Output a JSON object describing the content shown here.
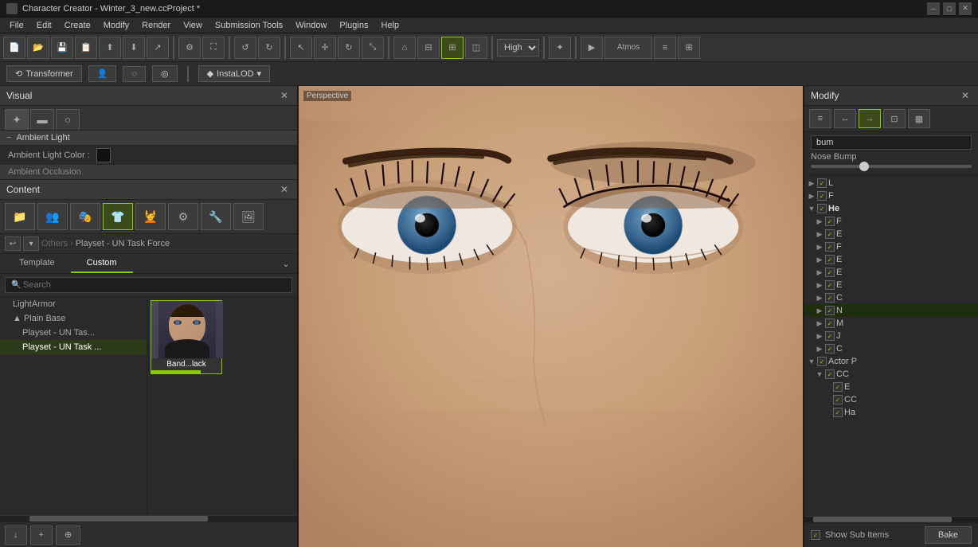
{
  "titleBar": {
    "title": "Character Creator - Winter_3_new.ccProject *",
    "icon": "★"
  },
  "menuBar": {
    "items": [
      "File",
      "Edit",
      "Create",
      "Modify",
      "Render",
      "View",
      "Submission Tools",
      "Window",
      "Plugins",
      "Help"
    ]
  },
  "toolbar": {
    "quality": "High",
    "atmos": "Atmos"
  },
  "subToolbar": {
    "transformer": "Transformer",
    "instaLOD": "InstaLOD"
  },
  "leftPanel": {
    "visualPanel": {
      "title": "Visual",
      "ambientLight": "Ambient Light",
      "ambientLightColor": "Ambient Light Color :",
      "ambientOcclusion": "Ambient Occlusion"
    },
    "contentPanel": {
      "title": "Content",
      "breadcrumb": [
        "Others",
        "Playset - UN Task Force"
      ],
      "tabs": [
        "Template",
        "Custom"
      ],
      "activeTab": "Custom",
      "searchPlaceholder": "Search",
      "listItems": [
        {
          "label": "LightArmor",
          "indent": 0,
          "selected": false
        },
        {
          "label": "▲ Plain Base",
          "indent": 0,
          "selected": false
        },
        {
          "label": "Playset - UN Tas...",
          "indent": 1,
          "selected": false
        },
        {
          "label": "Playset - UN Task ...",
          "indent": 1,
          "selected": true
        }
      ],
      "thumbItems": [
        {
          "label": "Band...lack",
          "selected": true
        }
      ],
      "bottomButtons": [
        "↓",
        "+",
        "⊕"
      ]
    }
  },
  "viewport": {
    "label": "Perspective"
  },
  "rightPanel": {
    "title": "Modify",
    "treeItems": [
      {
        "label": "L",
        "level": 0,
        "checked": true,
        "expanded": false
      },
      {
        "label": "F",
        "level": 0,
        "checked": true,
        "expanded": false
      },
      {
        "label": "He",
        "level": 0,
        "checked": true,
        "expanded": true,
        "bold": true
      },
      {
        "label": "F",
        "level": 1,
        "checked": true,
        "expanded": false
      },
      {
        "label": "E",
        "level": 1,
        "checked": true,
        "expanded": false
      },
      {
        "label": "F",
        "level": 1,
        "checked": true,
        "expanded": false
      },
      {
        "label": "E",
        "level": 1,
        "checked": true,
        "expanded": false
      },
      {
        "label": "E",
        "level": 1,
        "checked": true,
        "expanded": false
      },
      {
        "label": "E",
        "level": 1,
        "checked": true,
        "expanded": false
      },
      {
        "label": "C",
        "level": 1,
        "checked": true,
        "expanded": false
      },
      {
        "label": "N",
        "level": 1,
        "checked": true,
        "expanded": false,
        "selected": true
      },
      {
        "label": "M",
        "level": 1,
        "checked": true,
        "expanded": false
      },
      {
        "label": "J",
        "level": 1,
        "checked": true,
        "expanded": false
      },
      {
        "label": "C",
        "level": 1,
        "checked": true,
        "expanded": false
      },
      {
        "label": "Actor P",
        "level": 0,
        "checked": true,
        "expanded": true
      },
      {
        "label": "CC",
        "level": 1,
        "checked": true,
        "expanded": true
      },
      {
        "label": "E",
        "level": 2,
        "checked": true,
        "expanded": false
      },
      {
        "label": "CC",
        "level": 2,
        "checked": true,
        "expanded": false
      },
      {
        "label": "Ha",
        "level": 2,
        "checked": true,
        "expanded": false
      }
    ],
    "properties": {
      "burn": "bum",
      "noseBump": "Nose Bump",
      "sliderValue": 0.3
    },
    "showSubItems": "Show Sub Items",
    "bake": "Bake"
  }
}
